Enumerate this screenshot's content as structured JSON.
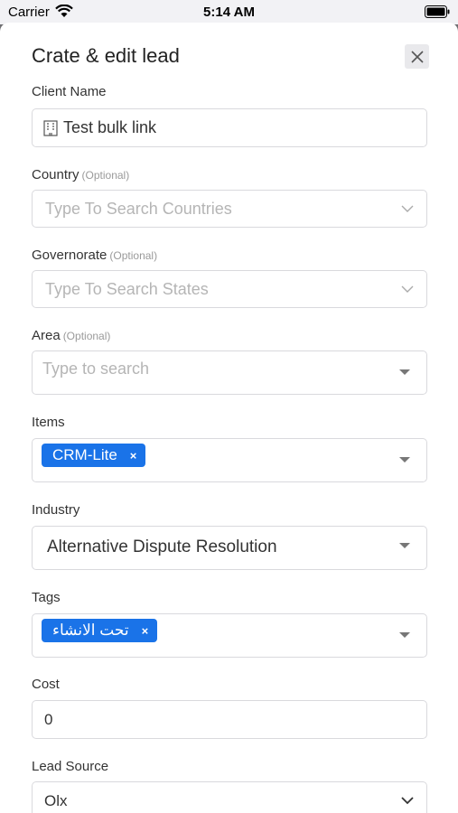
{
  "status_bar": {
    "carrier": "Carrier",
    "time": "5:14 AM"
  },
  "dialog": {
    "title": "Crate & edit lead"
  },
  "fields": {
    "client_name": {
      "label": "Client Name",
      "value": "Test bulk link"
    },
    "country": {
      "label": "Country",
      "optional": "(Optional)",
      "placeholder": "Type To Search Countries"
    },
    "governorate": {
      "label": "Governorate",
      "optional": "(Optional)",
      "placeholder": "Type To Search States"
    },
    "area": {
      "label": "Area",
      "optional": "(Optional)",
      "placeholder": "Type to search"
    },
    "items": {
      "label": "Items",
      "chips": [
        "CRM-Lite"
      ]
    },
    "industry": {
      "label": "Industry",
      "value": "Alternative Dispute Resolution"
    },
    "tags": {
      "label": "Tags",
      "chips": [
        "تحت الانشاء"
      ]
    },
    "cost": {
      "label": "Cost",
      "value": "0"
    },
    "lead_source": {
      "label": "Lead Source",
      "value": "Olx"
    }
  },
  "chip_remove": "×",
  "colors": {
    "accent": "#1a73e8",
    "border": "#d9d9dd",
    "placeholder": "#b5b5b5"
  }
}
